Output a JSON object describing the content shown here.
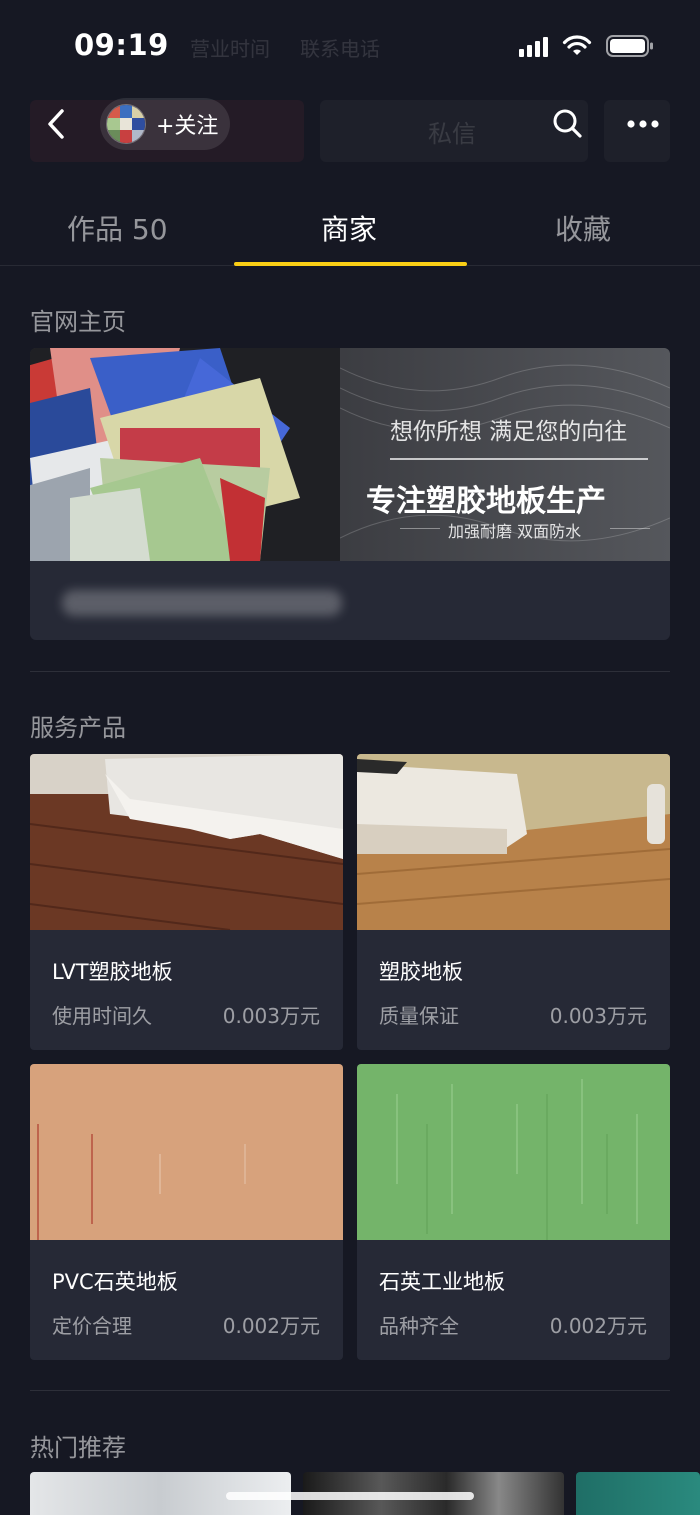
{
  "status_bar": {
    "time": "09:19",
    "ghost_items": [
      "营业时间",
      "联系电话"
    ]
  },
  "nav": {
    "follow_label": "+关注",
    "ghost_text": "私信"
  },
  "tabs": [
    {
      "label": "作品 50",
      "active": false
    },
    {
      "label": "商家",
      "active": true
    },
    {
      "label": "收藏",
      "active": false
    }
  ],
  "sections": {
    "homepage_title": "官网主页",
    "services_title": "服务产品",
    "hot_title": "热门推荐"
  },
  "banner": {
    "subtitle": "想你所想 满足您的向往",
    "headline": "专注塑胶地板生产",
    "tagline": "加强耐磨 双面防水"
  },
  "products": [
    {
      "name": "LVT塑胶地板",
      "desc": "使用时间久",
      "price": "0.003万元"
    },
    {
      "name": "塑胶地板",
      "desc": "质量保证",
      "price": "0.003万元"
    },
    {
      "name": "PVC石英地板",
      "desc": "定价合理",
      "price": "0.002万元"
    },
    {
      "name": "石英工业地板",
      "desc": "品种齐全",
      "price": "0.002万元"
    }
  ],
  "colors": {
    "background": "#161823",
    "card": "#262936",
    "tab_indicator": "#face15"
  }
}
